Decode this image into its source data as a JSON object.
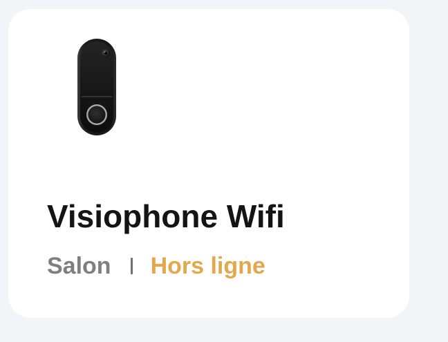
{
  "device": {
    "name": "Visiophone Wifi",
    "room": "Salon",
    "status": "Hors ligne",
    "status_color": "#e3a84a",
    "icon": "video-doorbell-icon"
  }
}
